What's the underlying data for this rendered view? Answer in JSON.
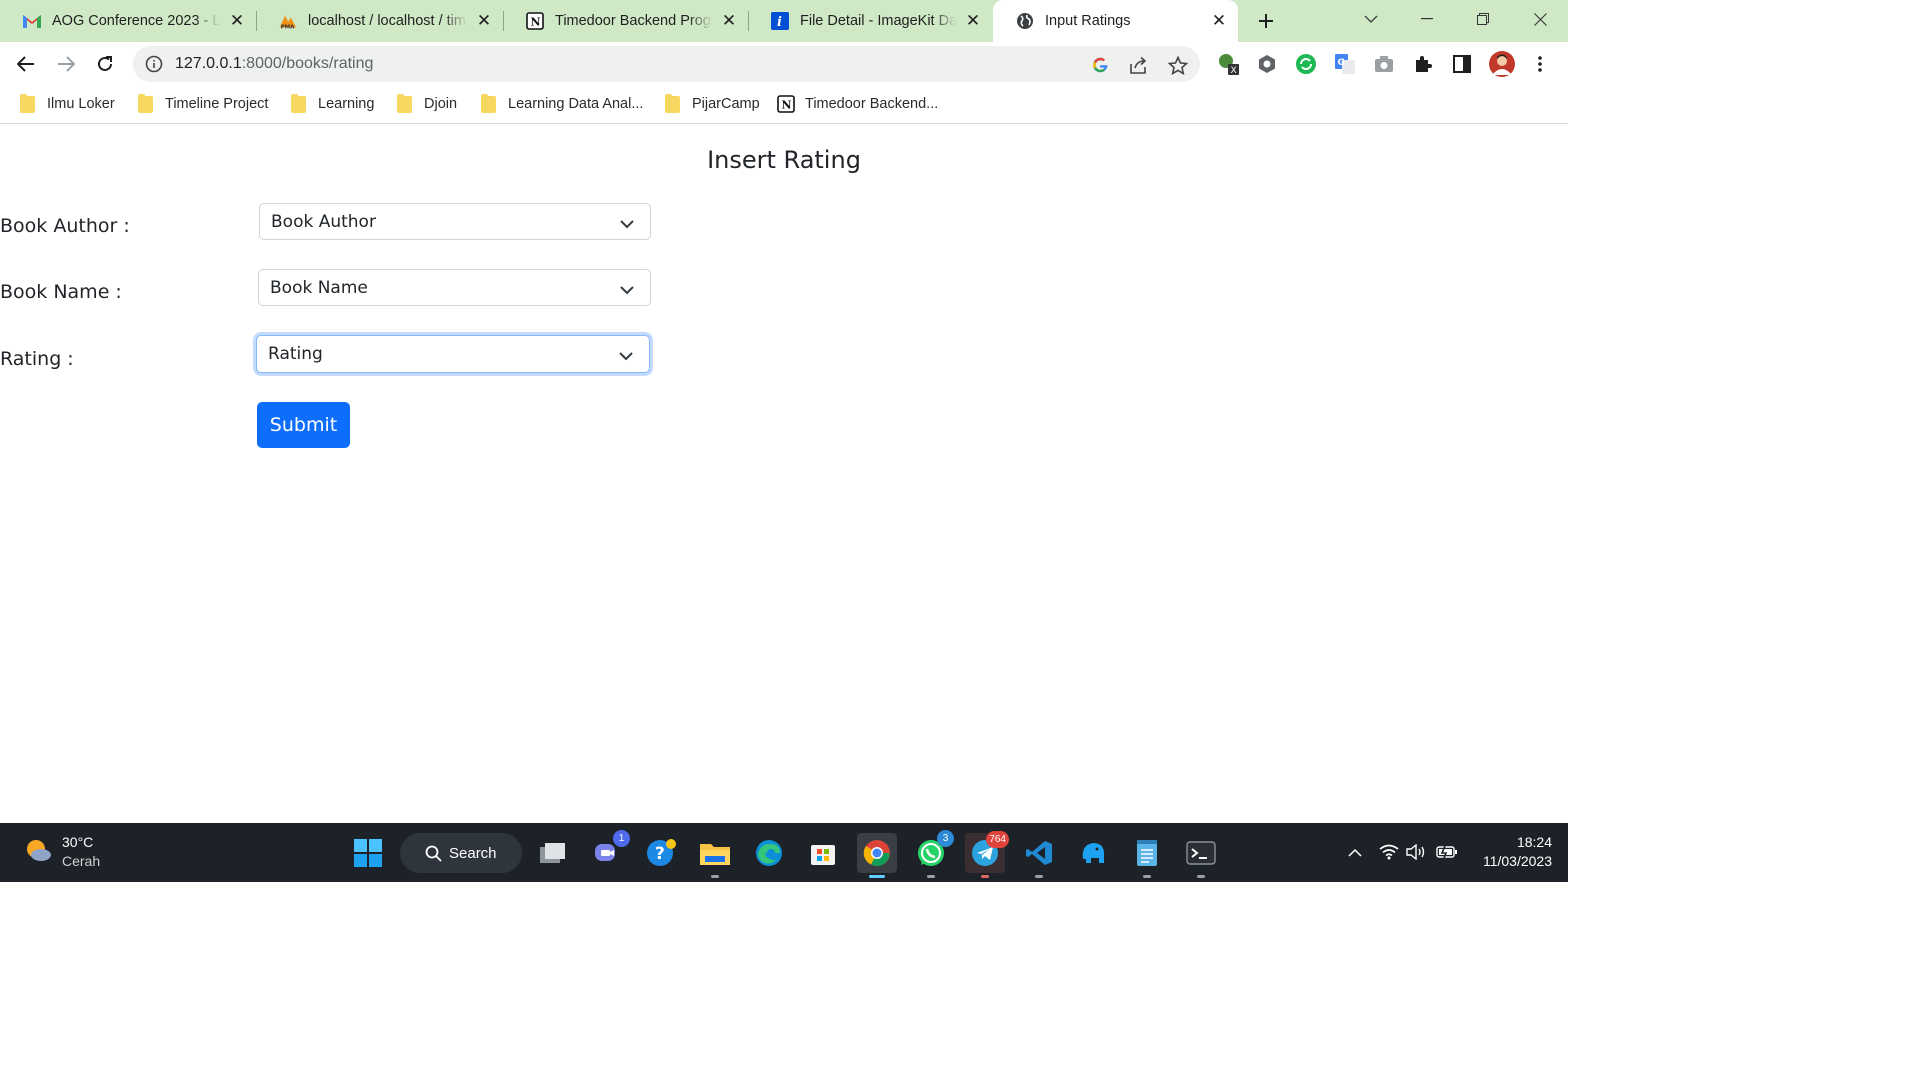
{
  "browser": {
    "tabs": [
      {
        "title": "AOG Conference 2023 - LinkedIn",
        "icon": "gmail-icon"
      },
      {
        "title": "localhost / localhost / timedoor",
        "icon": "phpmyadmin-icon"
      },
      {
        "title": "Timedoor Backend Programming",
        "icon": "notion-icon"
      },
      {
        "title": "File Detail - ImageKit Dashboard",
        "icon": "imagekit-icon"
      },
      {
        "title": "Input Ratings",
        "icon": "globe-icon",
        "active": true
      }
    ],
    "address": {
      "host": "127.0.0.1",
      "port_path": ":8000/books/rating"
    },
    "bookmarks": [
      {
        "label": "Ilmu Loker",
        "icon": "folder-icon"
      },
      {
        "label": "Timeline Project",
        "icon": "folder-icon"
      },
      {
        "label": "Learning",
        "icon": "folder-icon"
      },
      {
        "label": "Djoin",
        "icon": "folder-icon"
      },
      {
        "label": "Learning Data Anal...",
        "icon": "folder-icon"
      },
      {
        "label": "PijarCamp",
        "icon": "folder-icon"
      },
      {
        "label": "Timedoor Backend...",
        "icon": "notion-icon"
      }
    ]
  },
  "page": {
    "heading": "Insert Rating",
    "fields": [
      {
        "label": "Book Author :",
        "placeholder": "Book Author"
      },
      {
        "label": "Book Name :",
        "placeholder": "Book Name"
      },
      {
        "label": "Rating :",
        "placeholder": "Rating"
      }
    ],
    "submit_label": "Submit",
    "accent_color": "#0d6efd"
  },
  "taskbar": {
    "weather": {
      "temp": "30°C",
      "condition": "Cerah"
    },
    "search_label": "Search",
    "badges": {
      "teams": "1",
      "whatsapp": "3",
      "telegram": "764"
    },
    "time": "18:24",
    "date": "11/03/2023"
  }
}
